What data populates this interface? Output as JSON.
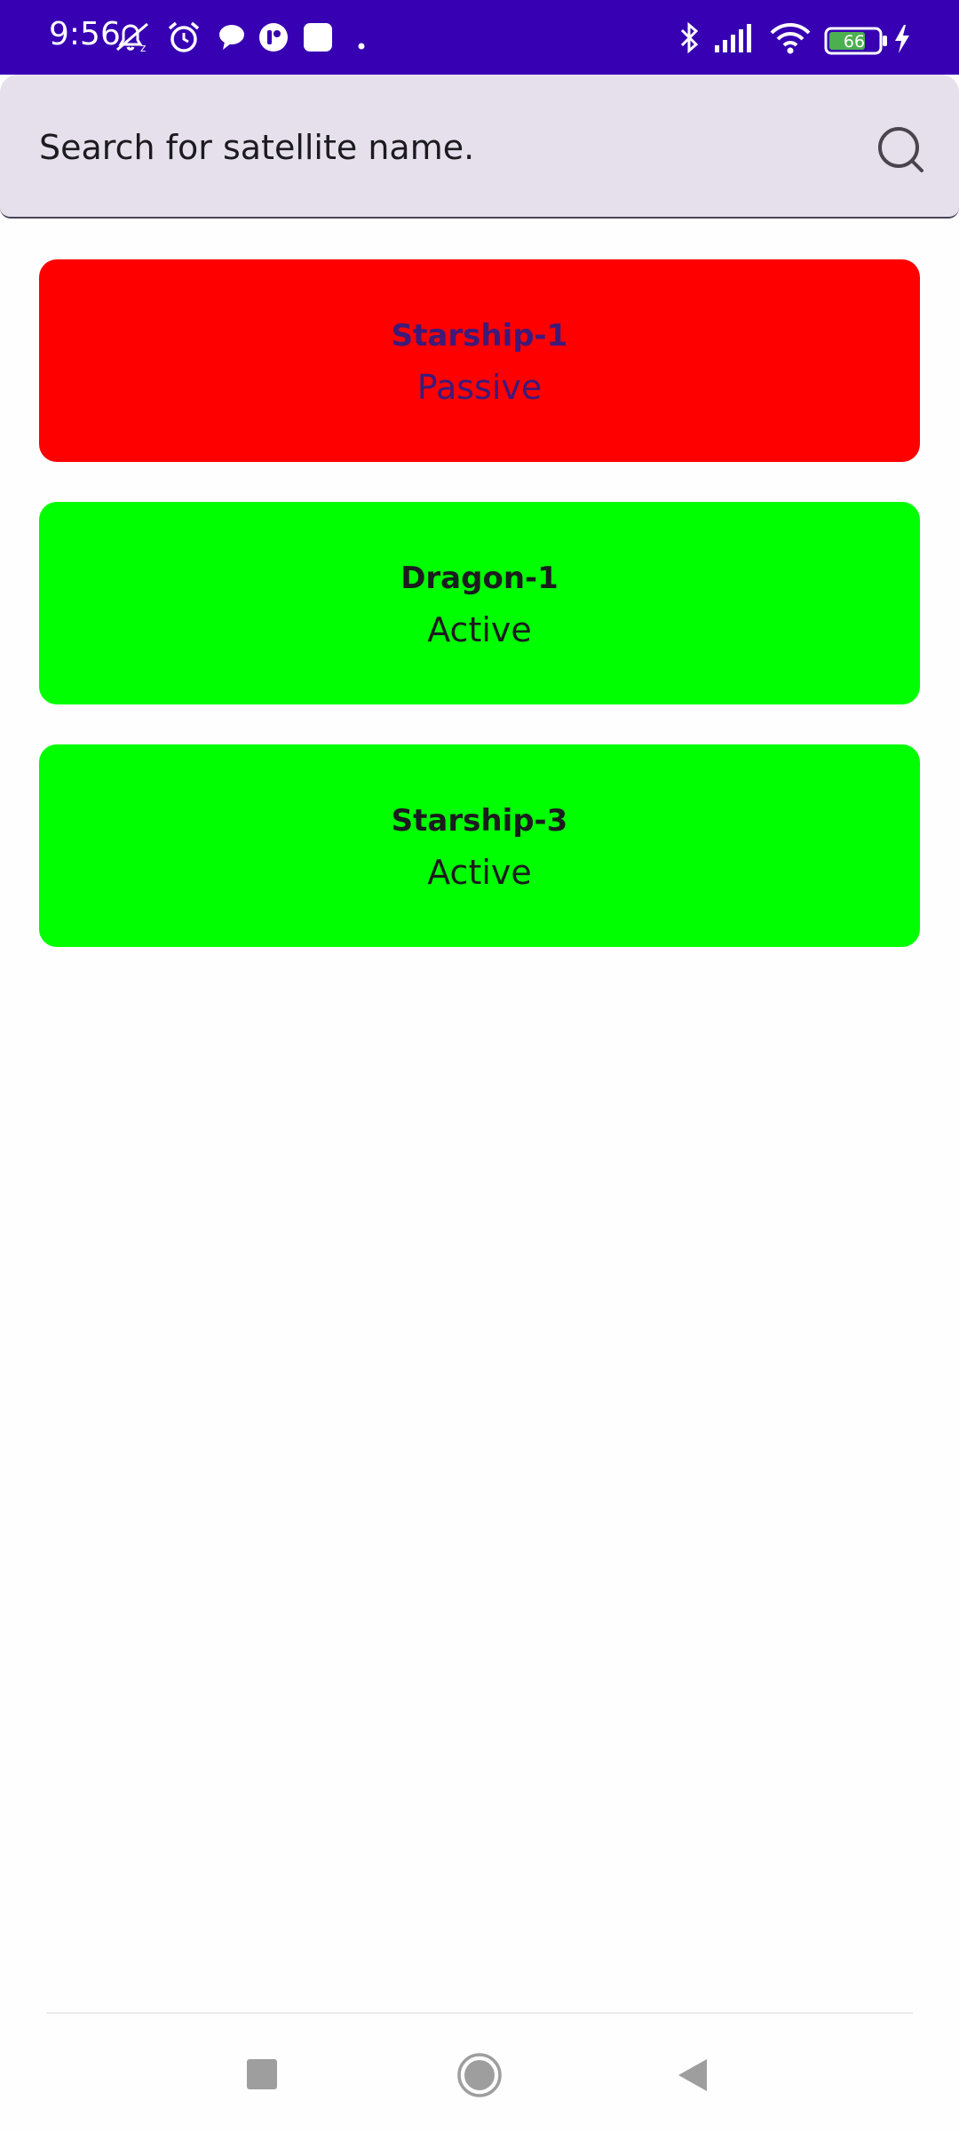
{
  "status_bar": {
    "time": "9:56",
    "battery_level": "66",
    "background_color": "#3700b3",
    "left_icons": [
      "muted-alarm-icon",
      "alarm-clock-icon",
      "chat-bubble-icon",
      "app-notification-icon",
      "square-notification-icon",
      "dot-icon"
    ],
    "right_icons": [
      "bluetooth-icon",
      "signal-icon",
      "wifi-icon",
      "battery-icon",
      "charging-icon"
    ]
  },
  "search": {
    "placeholder": "Search for satellite name."
  },
  "satellites": [
    {
      "name": "Starship-1",
      "status": "Passive",
      "color": "#ff0000",
      "text_color": "#3d1a7a"
    },
    {
      "name": "Dragon-1",
      "status": "Active",
      "color": "#00ff00",
      "text_color": "#1c1b1f"
    },
    {
      "name": "Starship-3",
      "status": "Active",
      "color": "#00ff00",
      "text_color": "#1c1b1f"
    }
  ],
  "nav_bar": {
    "buttons": [
      "recents-square-icon",
      "home-circle-icon",
      "back-triangle-icon"
    ]
  }
}
